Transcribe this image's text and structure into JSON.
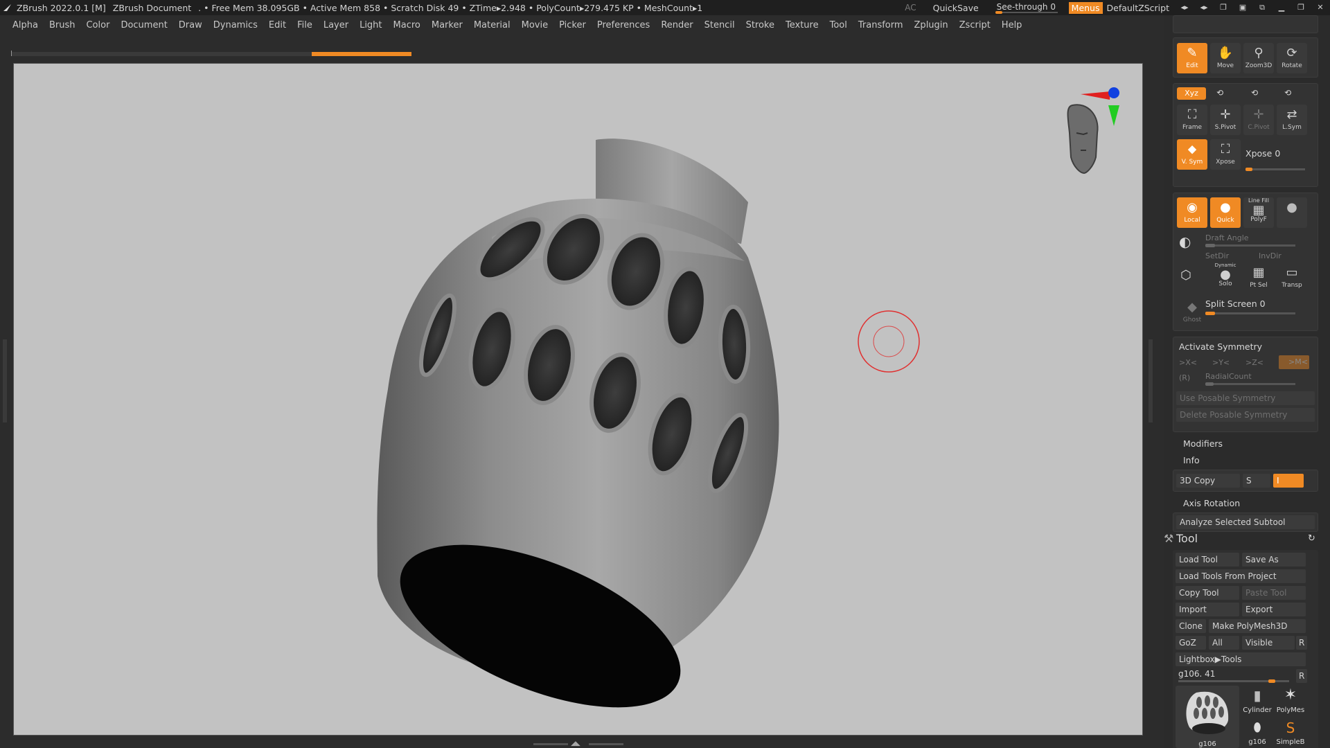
{
  "titlebar": {
    "app": "ZBrush 2022.0.1 [M]",
    "document": "ZBrush Document",
    "stats": ". • Free Mem 38.095GB • Active Mem 858 • Scratch Disk 49 • ZTime▸2.948 • PolyCount▸279.475 KP • MeshCount▸1",
    "ac": "AC",
    "quicksave": "QuickSave",
    "seethrough": "See-through  0",
    "seethrough_value": 0,
    "menus": "Menus",
    "default_zscript": "DefaultZScript"
  },
  "menu": [
    "Alpha",
    "Brush",
    "Color",
    "Document",
    "Draw",
    "Dynamics",
    "Edit",
    "File",
    "Layer",
    "Light",
    "Macro",
    "Marker",
    "Material",
    "Movie",
    "Picker",
    "Preferences",
    "Render",
    "Stencil",
    "Stroke",
    "Texture",
    "Tool",
    "Transform",
    "Zplugin",
    "Zscript",
    "Help"
  ],
  "colors": {
    "accent": "#f08a24",
    "viewport_bg": "#c2c2c2",
    "panel_bg": "#2b2b2b",
    "axis_x": "#e02020",
    "axis_y": "#22cc22",
    "axis_z": "#1040e0",
    "cursor": "#e03030"
  },
  "nav": {
    "edit": "Edit",
    "move": "Move",
    "zoom3d": "Zoom3D",
    "rotate": "Rotate",
    "xyz": "Xyz",
    "frame": "Frame",
    "spivot": "S.Pivot",
    "cpivot": "C.Pivot",
    "lsym": "L.Sym",
    "vsym": "V. Sym",
    "xpose_btn": "Xpose",
    "xpose_slider": "Xpose 0",
    "local": "Local",
    "quick": "Quick",
    "line_fill": "Line Fill",
    "polyf": "PolyF",
    "draft_angle": "Draft Angle",
    "setdir": "SetDir",
    "invdir": "InvDir",
    "dynamic": "Dynamic",
    "solo": "Solo",
    "ptsel": "Pt Sel",
    "transp": "Transp",
    "ghost": "Ghost",
    "split_screen": "Split Screen 0"
  },
  "symmetry": {
    "activate": "Activate Symmetry",
    "x": ">X<",
    "y": ">Y<",
    "z": ">Z<",
    "m": ">M<",
    "r": "(R)",
    "radial": "RadialCount",
    "use_posable": "Use Posable Symmetry",
    "delete_posable": "Delete Posable Symmetry"
  },
  "sections": {
    "modifiers": "Modifiers",
    "info": "Info",
    "copy3d": "3D Copy",
    "s": "S",
    "i": "I",
    "axis_rotation": "Axis Rotation",
    "analyze": "Analyze Selected Subtool"
  },
  "tool": {
    "title": "Tool",
    "load_tool": "Load Tool",
    "save_as": "Save As",
    "load_from_project": "Load Tools From Project",
    "copy_tool": "Copy Tool",
    "paste_tool": "Paste Tool",
    "import": "Import",
    "export": "Export",
    "clone": "Clone",
    "make_polymesh": "Make PolyMesh3D",
    "goz": "GoZ",
    "all": "All",
    "visible": "Visible",
    "r": "R",
    "lightbox_tools": "Lightbox▶Tools",
    "current_tool": "g106. 41",
    "thumb_main": "g106",
    "thumb_cylinder": "Cylinder",
    "thumb_polymesh": "PolyMes",
    "thumb_g106": "g106",
    "thumb_simpleb": "SimpleB"
  }
}
